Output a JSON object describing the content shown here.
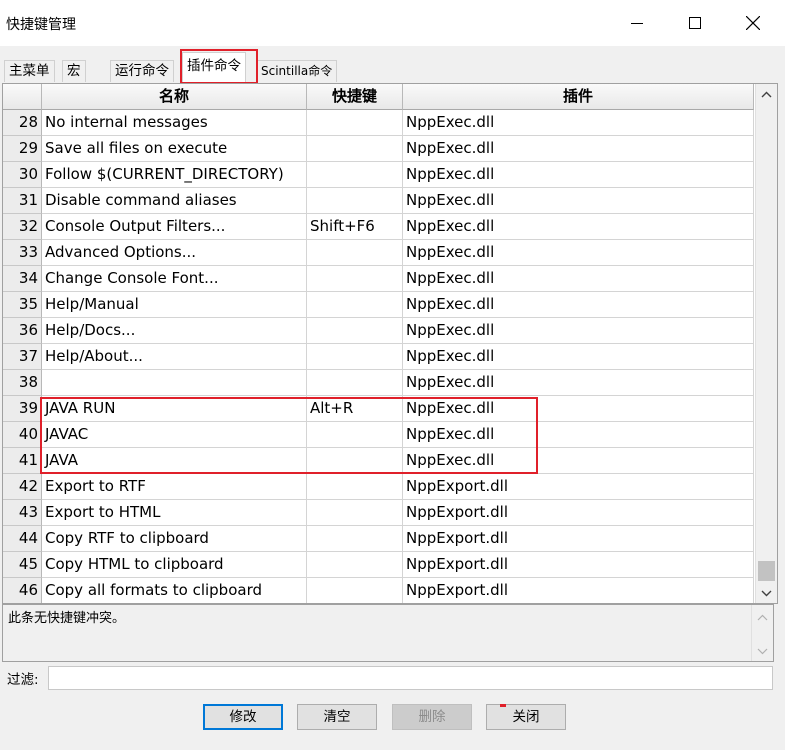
{
  "window": {
    "title": "快捷键管理"
  },
  "tabs": [
    {
      "label": "主菜单",
      "active": false
    },
    {
      "label": "宏",
      "active": false
    },
    {
      "label": "运行命令",
      "active": false
    },
    {
      "label": "插件命令",
      "active": true
    },
    {
      "label": "Scintilla命令",
      "active": false
    }
  ],
  "grid": {
    "columns": [
      "名称",
      "快捷键",
      "插件"
    ],
    "rows": [
      {
        "num": "28",
        "name": "No internal messages",
        "shortcut": "",
        "plugin": "NppExec.dll"
      },
      {
        "num": "29",
        "name": "Save all files on execute",
        "shortcut": "",
        "plugin": "NppExec.dll"
      },
      {
        "num": "30",
        "name": "Follow $(CURRENT_DIRECTORY)",
        "shortcut": "",
        "plugin": "NppExec.dll"
      },
      {
        "num": "31",
        "name": "Disable command aliases",
        "shortcut": "",
        "plugin": "NppExec.dll"
      },
      {
        "num": "32",
        "name": "Console Output Filters...",
        "shortcut": "Shift+F6",
        "plugin": "NppExec.dll"
      },
      {
        "num": "33",
        "name": "Advanced Options...",
        "shortcut": "",
        "plugin": "NppExec.dll"
      },
      {
        "num": "34",
        "name": "Change Console Font...",
        "shortcut": "",
        "plugin": "NppExec.dll"
      },
      {
        "num": "35",
        "name": "Help/Manual",
        "shortcut": "",
        "plugin": "NppExec.dll"
      },
      {
        "num": "36",
        "name": "Help/Docs...",
        "shortcut": "",
        "plugin": "NppExec.dll"
      },
      {
        "num": "37",
        "name": "Help/About...",
        "shortcut": "",
        "plugin": "NppExec.dll"
      },
      {
        "num": "38",
        "name": "",
        "shortcut": "",
        "plugin": "NppExec.dll"
      },
      {
        "num": "39",
        "name": "JAVA RUN",
        "shortcut": "Alt+R",
        "plugin": "NppExec.dll"
      },
      {
        "num": "40",
        "name": "JAVAC",
        "shortcut": "",
        "plugin": "NppExec.dll"
      },
      {
        "num": "41",
        "name": "JAVA",
        "shortcut": "",
        "plugin": "NppExec.dll"
      },
      {
        "num": "42",
        "name": "Export to RTF",
        "shortcut": "",
        "plugin": "NppExport.dll"
      },
      {
        "num": "43",
        "name": "Export to HTML",
        "shortcut": "",
        "plugin": "NppExport.dll"
      },
      {
        "num": "44",
        "name": "Copy RTF to clipboard",
        "shortcut": "",
        "plugin": "NppExport.dll"
      },
      {
        "num": "45",
        "name": "Copy HTML to clipboard",
        "shortcut": "",
        "plugin": "NppExport.dll"
      },
      {
        "num": "46",
        "name": "Copy all formats to clipboard",
        "shortcut": "",
        "plugin": "NppExport.dll"
      }
    ]
  },
  "conflict": {
    "message": "此条无快捷键冲突。"
  },
  "filter": {
    "label": "过滤:",
    "value": ""
  },
  "buttons": {
    "modify": "修改",
    "clear": "清空",
    "delete": "删除",
    "close": "关闭"
  },
  "colors": {
    "highlight": "#e0202a",
    "focus": "#0078d7"
  }
}
